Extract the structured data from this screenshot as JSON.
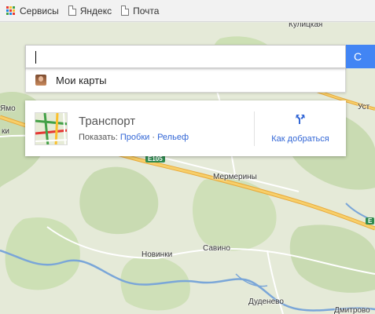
{
  "bookmarks": {
    "items": [
      {
        "label": "Сервисы",
        "icon": "apps-grid-icon"
      },
      {
        "label": "Яндекс",
        "icon": "page-icon"
      },
      {
        "label": "Почта",
        "icon": "page-icon"
      }
    ]
  },
  "search": {
    "placeholder": "",
    "value": "",
    "button_label": "С"
  },
  "dropdown": {
    "my_maps_label": "Мои карты"
  },
  "transport_card": {
    "title": "Транспорт",
    "show_prefix": "Показать:",
    "traffic_link": "Пробки",
    "separator": " · ",
    "terrain_link": "Рельеф",
    "directions_label": "Как добраться"
  },
  "map": {
    "labels": {
      "kulitskaya": "Кулицкая",
      "yamo": "Ямо",
      "ki": "ки",
      "ust": "Уст",
      "mermeriny": "Мермерины",
      "novinki": "Новинки",
      "savino": "Савино",
      "dudenevo": "Дуденево",
      "dmitrovo": "Дмитрово"
    },
    "road_badges": {
      "e105": "E105",
      "e": "E"
    }
  },
  "colors": {
    "accent": "#4285f4",
    "link": "#3367d6",
    "highway": "#f2b84b",
    "water": "#7aa6d8",
    "forest": "#c9dbb2"
  }
}
